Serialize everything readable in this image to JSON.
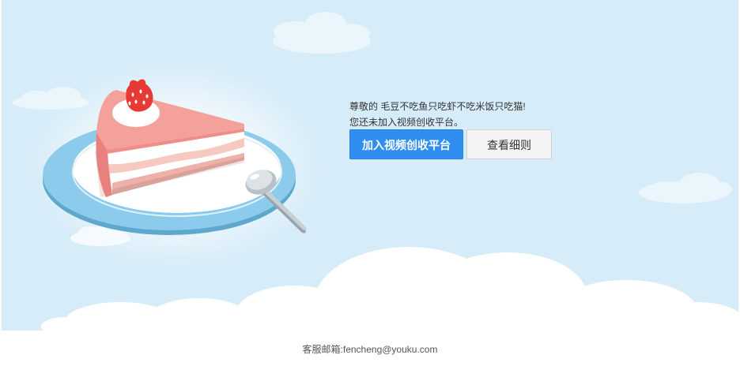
{
  "user": {
    "greeting": "尊敬的 毛豆不吃鱼只吃虾不吃米饭只吃猫!",
    "notice": "您还未加入视频创收平台。"
  },
  "actions": {
    "join_label": "加入视频创收平台",
    "rules_label": "查看细则"
  },
  "footer": {
    "contact": "客服邮箱:fencheng@youku.com"
  },
  "colors": {
    "sky": "#d6ecf8",
    "primary_button": "#2f8ef0",
    "plate": "#8ccbec",
    "cake_top": "#f4a19b",
    "strawberry": "#e73a35"
  },
  "illustration": {
    "subject": "cake-slice-on-plate",
    "icons": [
      "cloud-icon",
      "plate-icon",
      "cake-slice-icon",
      "strawberry-icon",
      "spoon-icon"
    ]
  }
}
